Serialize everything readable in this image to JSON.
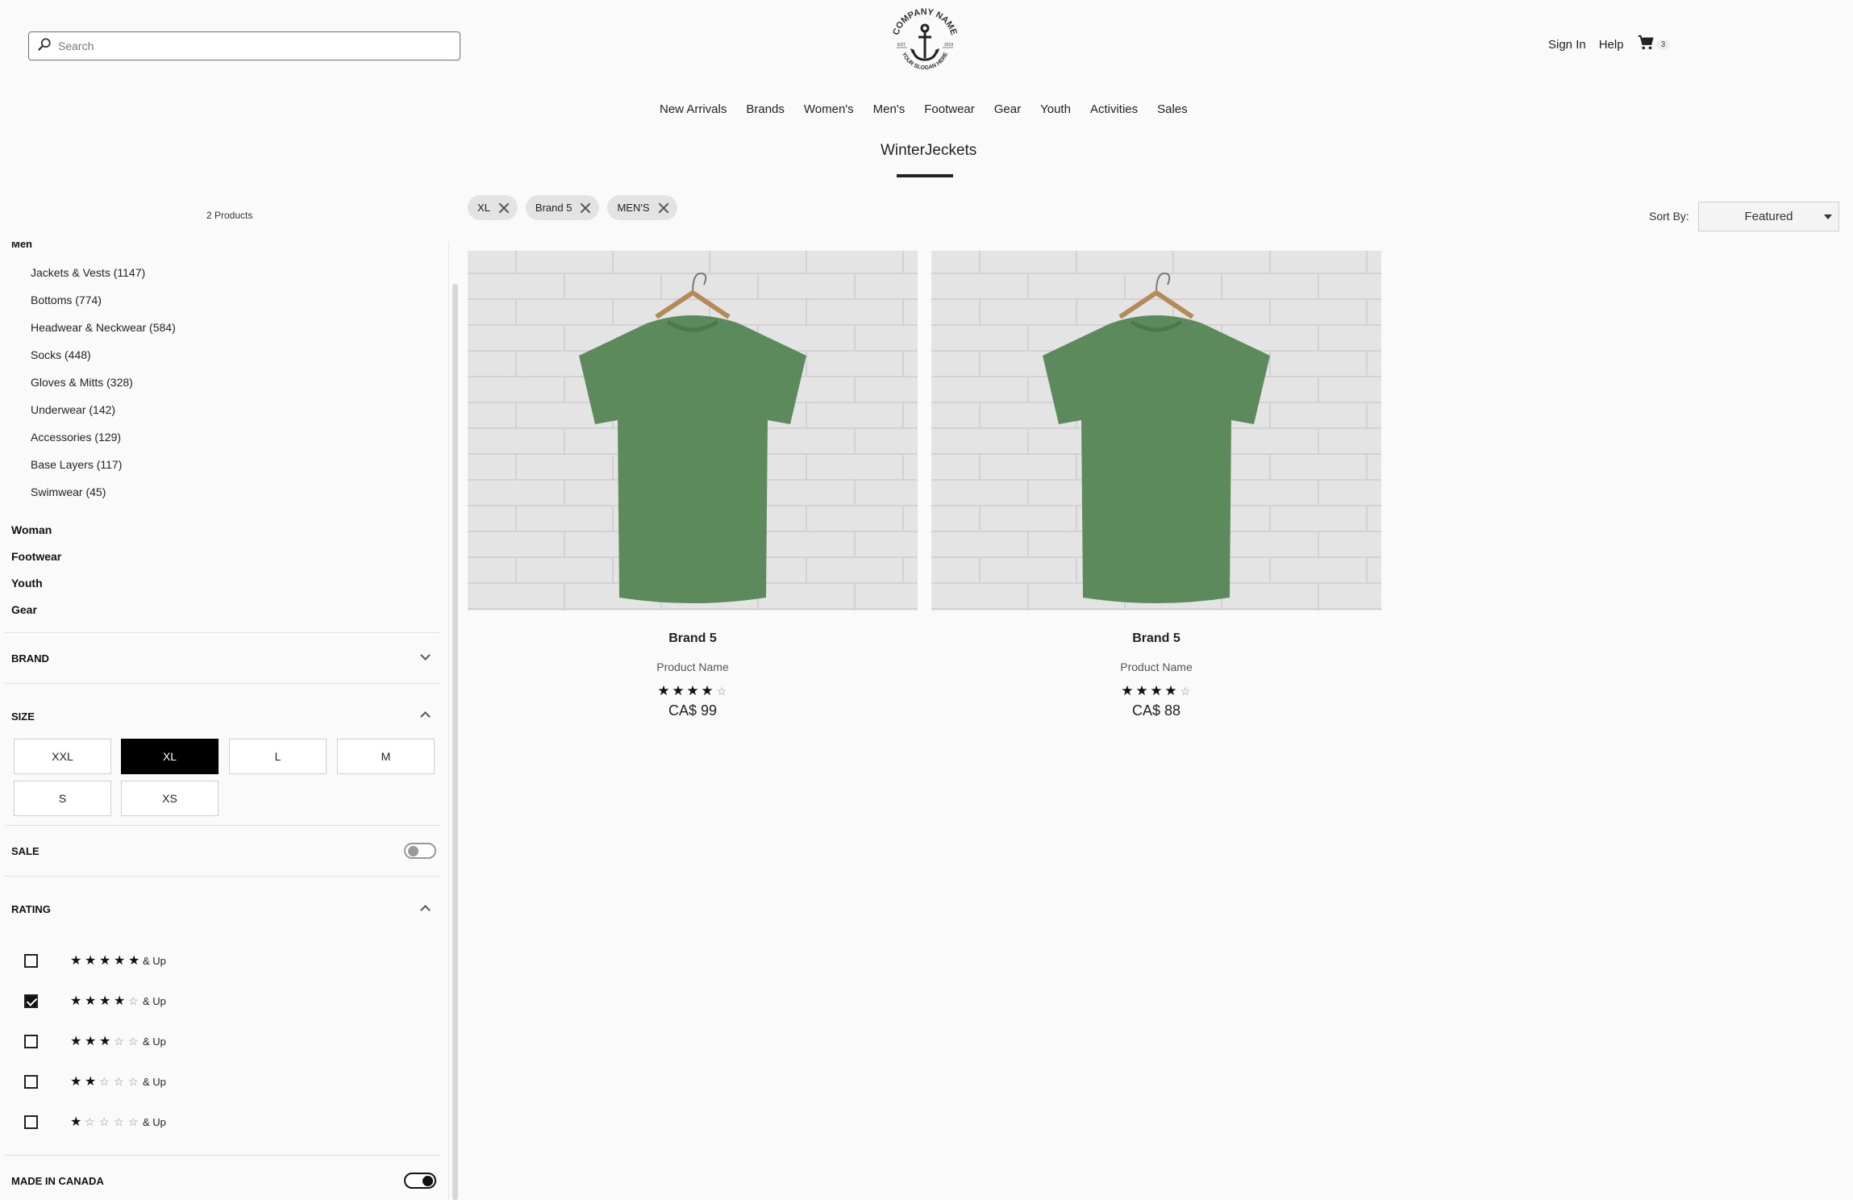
{
  "header": {
    "search_placeholder": "Search",
    "logo_text_top": "COMPANY NAME",
    "logo_text_bottom": "YOUR SLOGAN HERE",
    "logo_est_left": "EST.",
    "logo_est_right": "2019",
    "sign_in": "Sign In",
    "help": "Help",
    "cart_count": "3"
  },
  "nav": {
    "items": [
      "New Arrivals",
      "Brands",
      "Women's",
      "Men's",
      "Footwear",
      "Gear",
      "Youth",
      "Activities",
      "Sales"
    ]
  },
  "page_title": "WinterJeckets",
  "results": {
    "product_count": "2 Products",
    "chips": [
      "XL",
      "Brand 5",
      "MEN'S"
    ],
    "sort_label": "Sort By:",
    "sort_value": "Featured"
  },
  "sidebar": {
    "category_header": "Men",
    "subcategories": [
      "Jackets & Vests (1147)",
      "Bottoms (774)",
      "Headwear & Neckwear (584)",
      "Socks (448)",
      "Gloves & Mitts (328)",
      "Underwear (142)",
      "Accessories (129)",
      "Base Layers (117)",
      "Swimwear (45)"
    ],
    "top_categories": [
      "Woman",
      "Footwear",
      "Youth",
      "Gear"
    ],
    "brand_title": "BRAND",
    "size_title": "SIZE",
    "sizes": [
      "XXL",
      "XL",
      "L",
      "M",
      "S",
      "XS"
    ],
    "selected_size": "XL",
    "sale_title": "SALE",
    "sale_on": false,
    "rating_title": "RATING",
    "rating_and_up": "& Up",
    "ratings": [
      {
        "stars": 5,
        "checked": false
      },
      {
        "stars": 4,
        "checked": true
      },
      {
        "stars": 3,
        "checked": false
      },
      {
        "stars": 2,
        "checked": false
      },
      {
        "stars": 1,
        "checked": false
      }
    ],
    "made_in_canada_title": "MADE IN CANADA",
    "made_in_canada_on": true
  },
  "products": [
    {
      "brand": "Brand 5",
      "name": "Product Name",
      "rating": 4,
      "price": "CA$ 99"
    },
    {
      "brand": "Brand 5",
      "name": "Product Name",
      "rating": 4,
      "price": "CA$ 88"
    }
  ],
  "colors": {
    "shirt": "#5d8a5c",
    "accent": "#111111"
  }
}
